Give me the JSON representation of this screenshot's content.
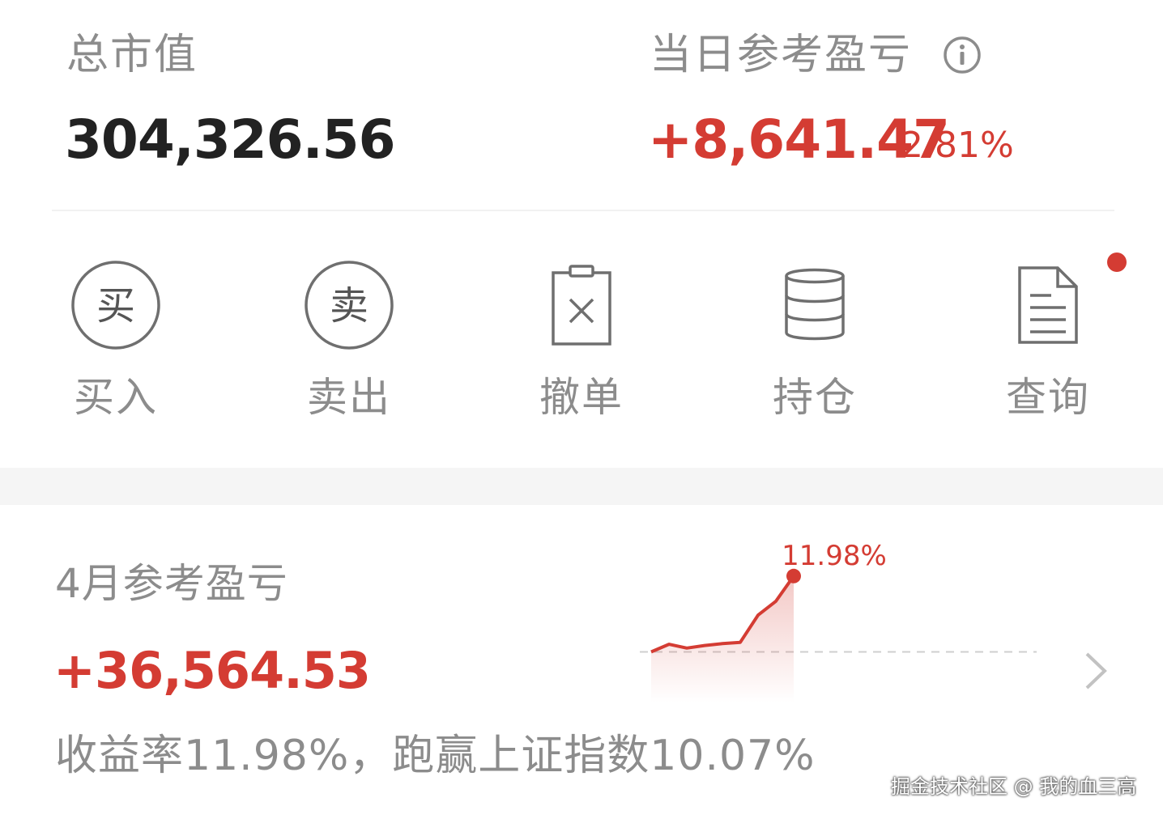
{
  "summary": {
    "total_label": "总市值",
    "total_value": "304,326.56",
    "daily_label": "当日参考盈亏",
    "daily_value": "+8,641.47",
    "daily_pct": "2.81%"
  },
  "actions": [
    {
      "label": "买入",
      "glyph": "买",
      "icon": "buy-icon"
    },
    {
      "label": "卖出",
      "glyph": "卖",
      "icon": "sell-icon"
    },
    {
      "label": "撤单",
      "icon": "cancel-order-icon"
    },
    {
      "label": "持仓",
      "icon": "position-icon"
    },
    {
      "label": "查询",
      "icon": "query-icon"
    }
  ],
  "month": {
    "title": "4月参考盈亏",
    "value": "+36,564.53",
    "desc": "收益率11.98%，跑赢上证指数10.07%"
  },
  "colors": {
    "accent_red": "#d43c33",
    "text_grey": "#8c8c8c",
    "text_dark": "#222222"
  },
  "chart_data": {
    "type": "line",
    "series": [
      {
        "values": [
          0,
          1.2,
          0.6,
          1.0,
          1.3,
          1.5,
          5.8,
          8.0,
          11.98
        ]
      }
    ],
    "annotations": [
      {
        "text": "11.98%",
        "point": "last"
      }
    ],
    "baseline": 0,
    "ylim": [
      -8,
      14
    ]
  },
  "watermark": "掘金技术社区 @ 我的血三高"
}
